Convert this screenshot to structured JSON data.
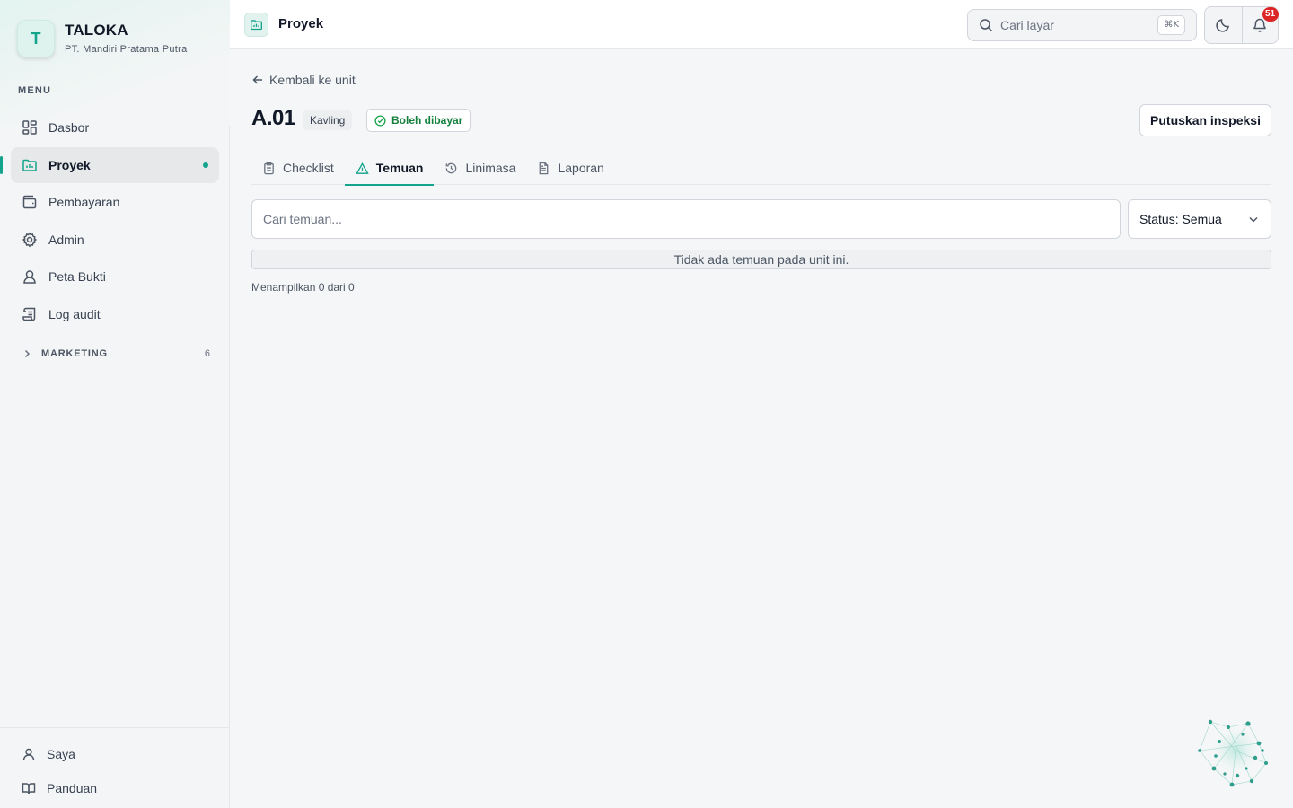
{
  "brand": {
    "logo_letter": "T",
    "name": "TALOKA",
    "company": "PT. Mandiri Pratama Putra"
  },
  "sidebar": {
    "menu_label": "MENU",
    "items": [
      {
        "label": "Dasbor",
        "icon": "grid-icon"
      },
      {
        "label": "Proyek",
        "icon": "project-chart-icon",
        "active": true
      },
      {
        "label": "Pembayaran",
        "icon": "wallet-icon"
      },
      {
        "label": "Admin",
        "icon": "gear-icon"
      },
      {
        "label": "Peta Bukti",
        "icon": "map-user-icon"
      },
      {
        "label": "Log audit",
        "icon": "scroll-log-icon"
      }
    ],
    "section": {
      "label": "MARKETING",
      "count": "6"
    },
    "footer": [
      {
        "label": "Saya",
        "icon": "user-icon"
      },
      {
        "label": "Panduan",
        "icon": "book-icon"
      }
    ]
  },
  "header": {
    "title": "Proyek",
    "search_placeholder": "Cari layar",
    "search_shortcut": "⌘K",
    "notification_count": "51"
  },
  "main": {
    "back_label": "Kembali ke unit",
    "unit_code": "A.01",
    "unit_type": "Kavling",
    "status": "Boleh dibayar",
    "action_button": "Putuskan inspeksi",
    "tabs": [
      {
        "label": "Checklist",
        "icon": "clipboard-icon"
      },
      {
        "label": "Temuan",
        "icon": "warning-triangle-icon",
        "active": true
      },
      {
        "label": "Linimasa",
        "icon": "history-icon"
      },
      {
        "label": "Laporan",
        "icon": "document-icon"
      }
    ],
    "filter_placeholder": "Cari temuan...",
    "status_filter": "Status: Semua",
    "empty_message": "Tidak ada temuan pada unit ini.",
    "count_text": "Menampilkan 0 dari 0"
  },
  "colors": {
    "accent": "#14a38b",
    "success": "#15803d",
    "badge": "#dc2626"
  }
}
